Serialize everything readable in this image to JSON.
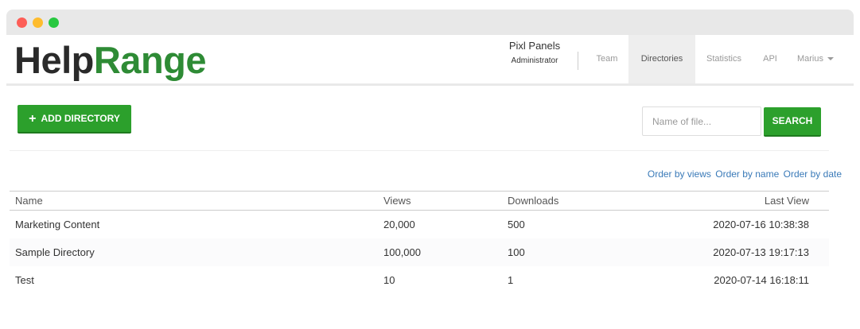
{
  "brand": {
    "part1": "Help",
    "part2": "Range"
  },
  "account": {
    "org": "Pixl Panels",
    "role": "Administrator"
  },
  "nav": {
    "items": [
      {
        "label": "Team"
      },
      {
        "label": "Directories"
      },
      {
        "label": "Statistics"
      },
      {
        "label": "API"
      },
      {
        "label": "Marius"
      }
    ]
  },
  "toolbar": {
    "add_label": "ADD DIRECTORY",
    "search_placeholder": "Name of file...",
    "search_label": "SEARCH"
  },
  "order": {
    "by_views": "Order by views",
    "by_name": "Order by name",
    "by_date": "Order by date"
  },
  "table": {
    "headers": {
      "name": "Name",
      "views": "Views",
      "downloads": "Downloads",
      "last_view": "Last View"
    },
    "rows": [
      {
        "name": "Marketing Content",
        "views": "20,000",
        "downloads": "500",
        "last_view": "2020-07-16 10:38:38"
      },
      {
        "name": "Sample Directory",
        "views": "100,000",
        "downloads": "100",
        "last_view": "2020-07-13 19:17:13"
      },
      {
        "name": "Test",
        "views": "10",
        "downloads": "1",
        "last_view": "2020-07-14 16:18:11"
      }
    ]
  },
  "colors": {
    "brand_green": "#2e8b35",
    "button_green": "#2ca02c",
    "link_blue": "#3a7ab8"
  }
}
